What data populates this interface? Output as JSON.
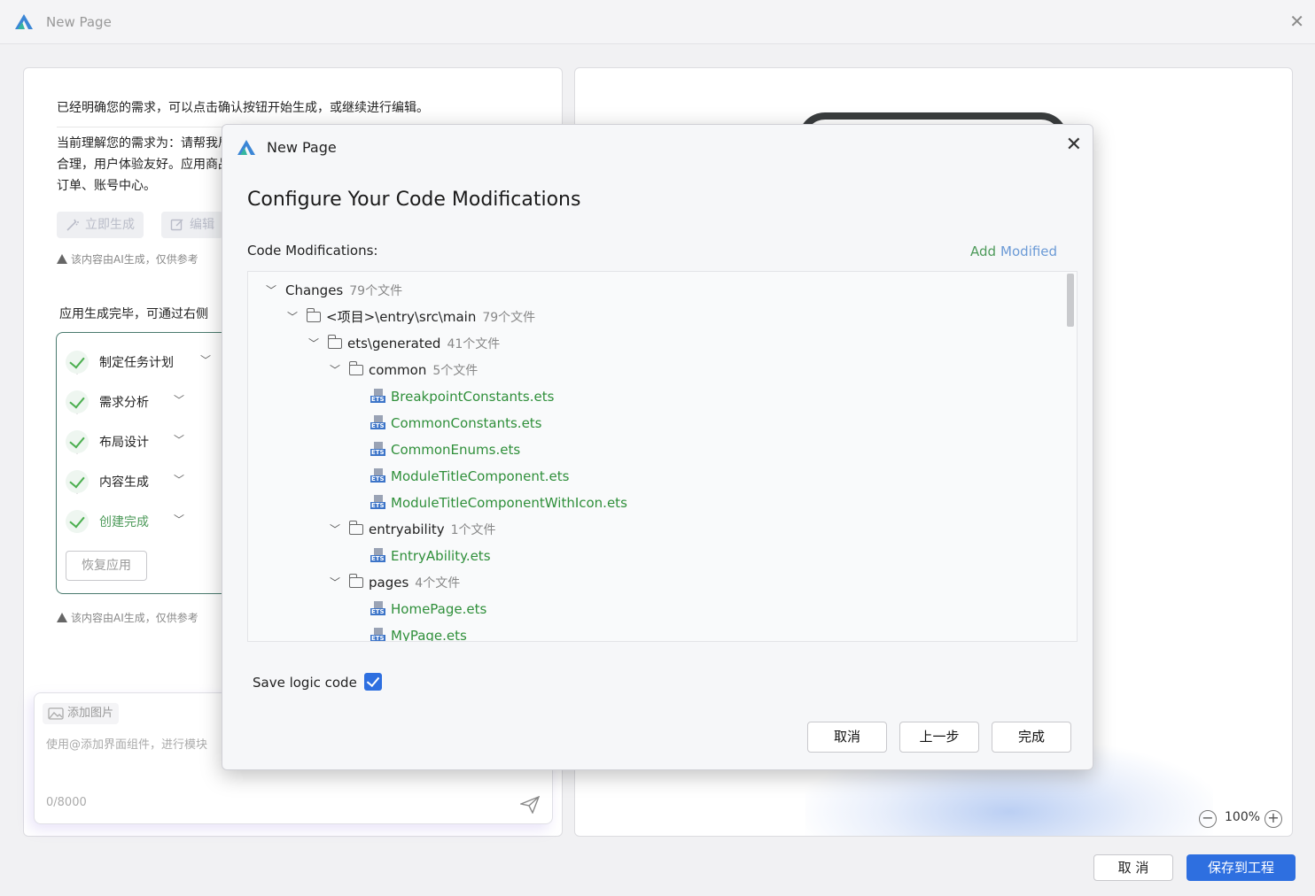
{
  "window": {
    "title": "New Page"
  },
  "left": {
    "confirm_text": "已经明确您的需求，可以点击确认按钮开始生成，或继续进行编辑。",
    "understanding_text": "当前理解您的需求为：请帮我局合理，用户体验友好。应用商品订单、账号中心。",
    "generate_button": "立即生成",
    "edit_button": "编辑",
    "ai_note": "该内容由AI生成，仅供参考",
    "done_text": "应用生成完毕，可通过右侧",
    "steps": [
      {
        "label": "制定任务计划"
      },
      {
        "label": "需求分析"
      },
      {
        "label": "布局设计"
      },
      {
        "label": "内容生成"
      },
      {
        "label": "创建完成"
      }
    ],
    "restore_button": "恢复应用",
    "add_image": "添加图片",
    "input_placeholder": "使用@添加界面组件，进行模块",
    "char_count": "0/8000"
  },
  "right": {
    "zoom": "100%"
  },
  "footer": {
    "cancel": "取 消",
    "save": "保存到工程"
  },
  "dialog": {
    "title": "New Page",
    "heading": "Configure Your Code Modifications",
    "label": "Code Modifications:",
    "add_label": "Add",
    "modified_label": "Modified",
    "tree": [
      {
        "kind": "folder-root",
        "name": "Changes",
        "count": "79个文件"
      },
      {
        "kind": "folder",
        "name": "<项目>\\entry\\src\\main",
        "count": "79个文件"
      },
      {
        "kind": "folder",
        "name": "ets\\generated",
        "count": "41个文件"
      },
      {
        "kind": "folder",
        "name": "common",
        "count": "5个文件"
      },
      {
        "kind": "file",
        "name": "BreakpointConstants.ets"
      },
      {
        "kind": "file",
        "name": "CommonConstants.ets"
      },
      {
        "kind": "file",
        "name": "CommonEnums.ets"
      },
      {
        "kind": "file",
        "name": "ModuleTitleComponent.ets"
      },
      {
        "kind": "file",
        "name": "ModuleTitleComponentWithIcon.ets"
      },
      {
        "kind": "folder",
        "name": "entryability",
        "count": "1个文件"
      },
      {
        "kind": "file",
        "name": "EntryAbility.ets"
      },
      {
        "kind": "folder",
        "name": "pages",
        "count": "4个文件"
      },
      {
        "kind": "file",
        "name": "HomePage.ets"
      },
      {
        "kind": "file",
        "name": "MyPage.ets"
      }
    ],
    "save_logic_label": "Save logic code",
    "save_logic_checked": true,
    "cancel_button": "取消",
    "prev_button": "上一步",
    "finish_button": "完成"
  },
  "colors": {
    "accent": "#2e6fe0",
    "file_green": "#2f8f3a",
    "check_green": "#4caf50"
  }
}
